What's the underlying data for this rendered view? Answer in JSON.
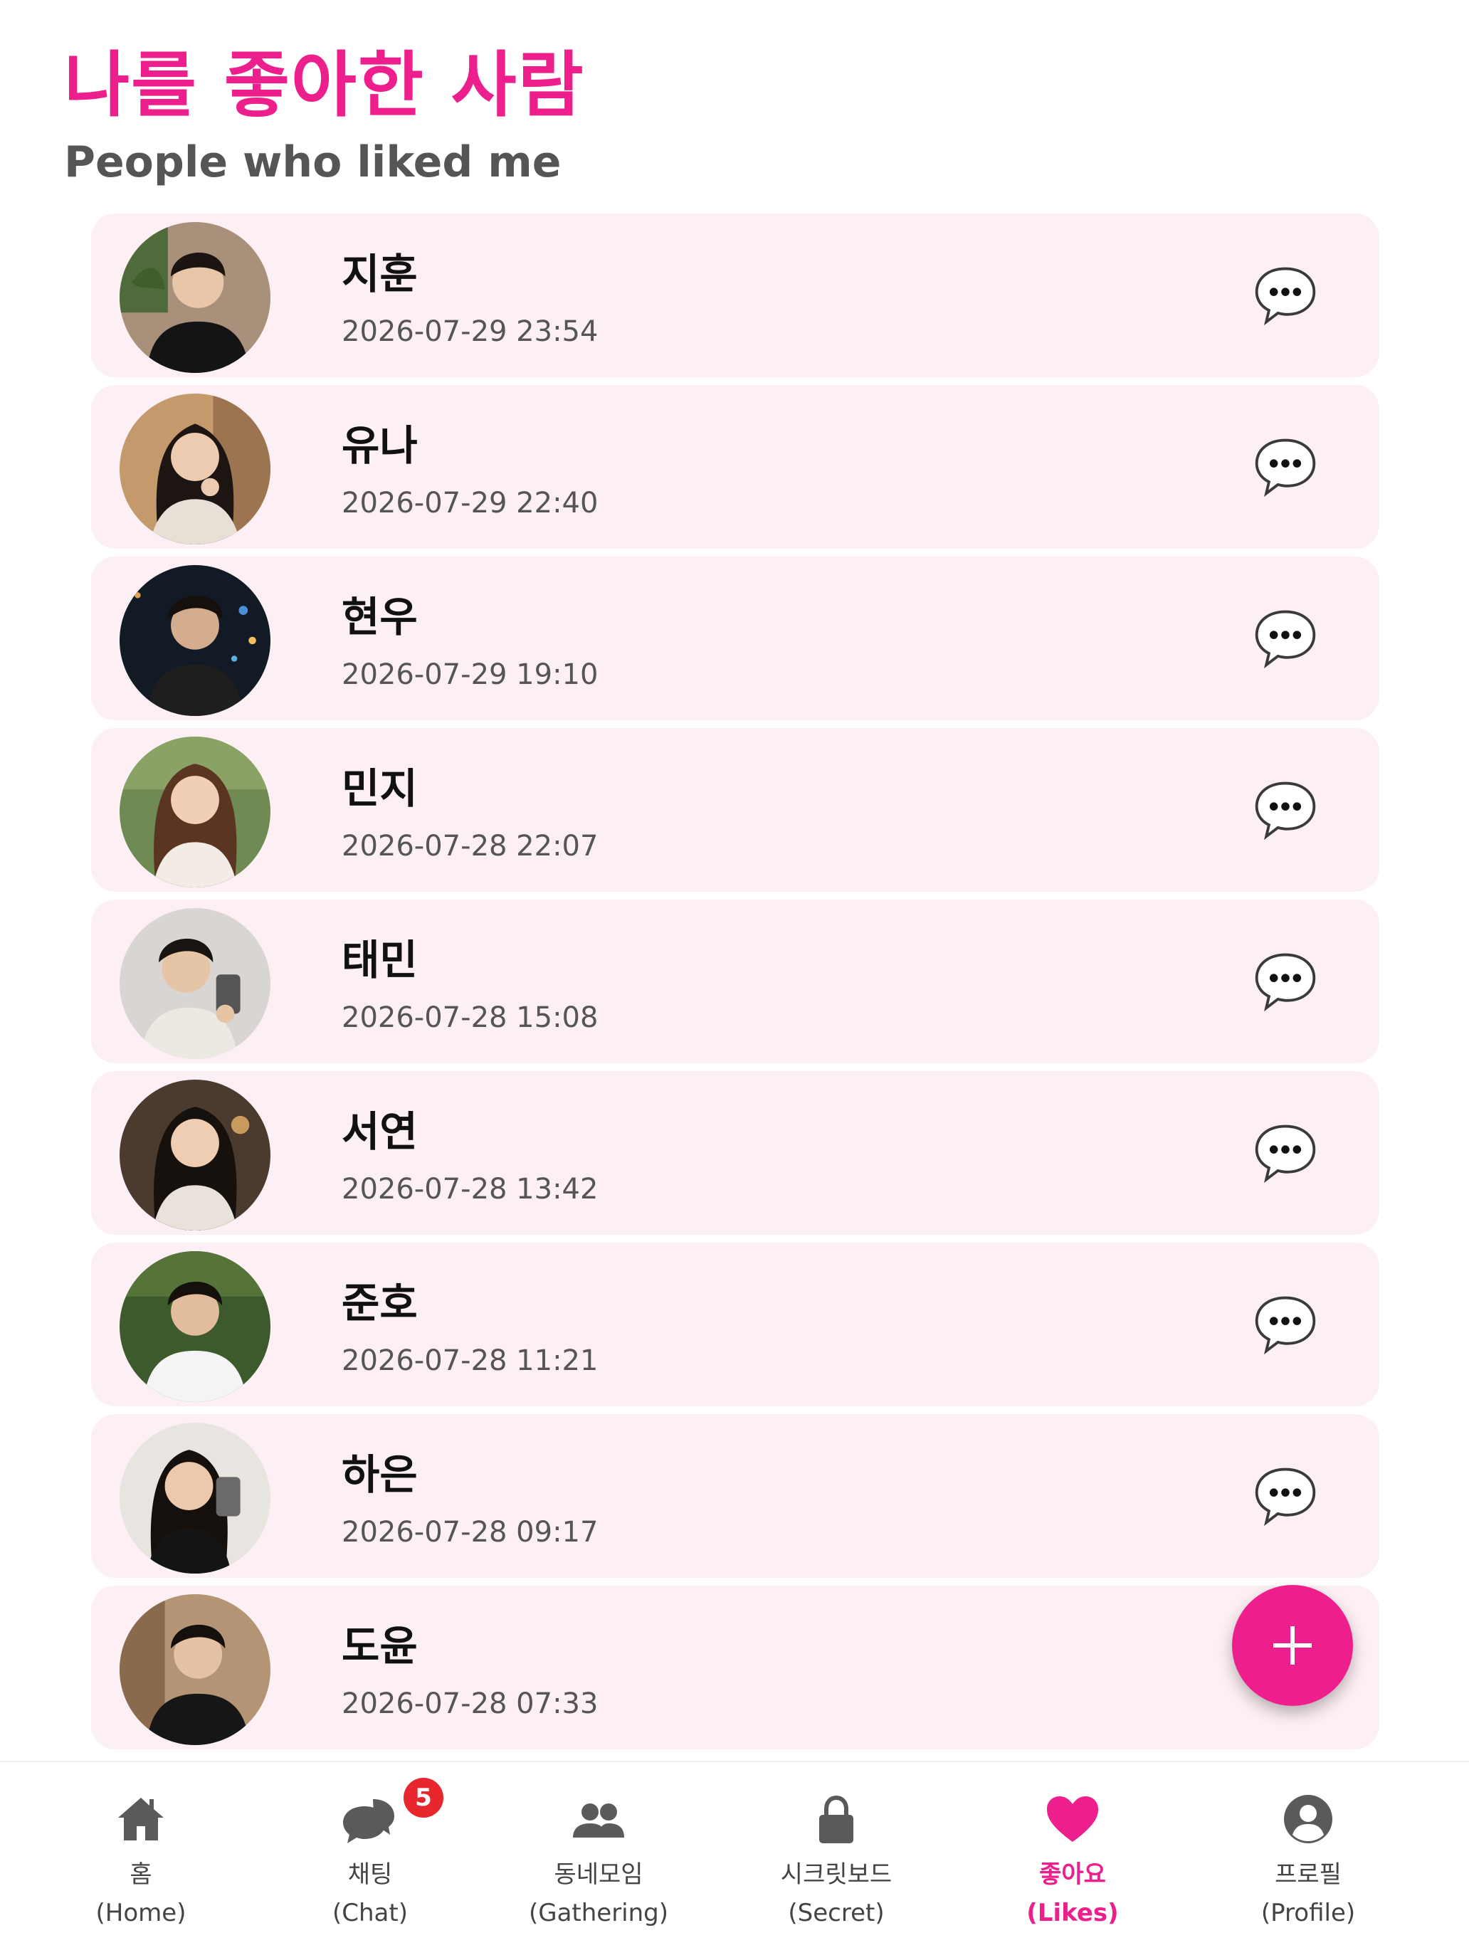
{
  "header": {
    "title": "나를 좋아한 사람",
    "subtitle": "People who liked me"
  },
  "likes": [
    {
      "name": "지훈",
      "time": "2026-07-29 23:54"
    },
    {
      "name": "유나",
      "time": "2026-07-29 22:40"
    },
    {
      "name": "현우",
      "time": "2026-07-29 19:10"
    },
    {
      "name": "민지",
      "time": "2026-07-28 22:07"
    },
    {
      "name": "태민",
      "time": "2026-07-28 15:08"
    },
    {
      "name": "서연",
      "time": "2026-07-28 13:42"
    },
    {
      "name": "준호",
      "time": "2026-07-28 11:21"
    },
    {
      "name": "하은",
      "time": "2026-07-28 09:17"
    },
    {
      "name": "도윤",
      "time": "2026-07-28 07:33"
    }
  ],
  "icons": {
    "chat_bubble": "chat-bubble-ellipsis-icon",
    "fab": "plus-icon"
  },
  "nav": {
    "items": [
      {
        "label": "홈",
        "sub": "(Home)",
        "icon": "home-icon"
      },
      {
        "label": "채팅",
        "sub": "(Chat)",
        "icon": "chat-icon",
        "badge": "5"
      },
      {
        "label": "동네모임",
        "sub": "(Gathering)",
        "icon": "group-icon"
      },
      {
        "label": "시크릿보드",
        "sub": "(Secret)",
        "icon": "lock-icon"
      },
      {
        "label": "좋아요",
        "sub": "(Likes)",
        "icon": "heart-icon"
      },
      {
        "label": "프로필",
        "sub": "(Profile)",
        "icon": "profile-icon"
      }
    ]
  },
  "colors": {
    "accent": "#ec1f8c",
    "card_background": "#fdf0f5",
    "badge": "#e8262e",
    "nav_icon": "#5a5a5a"
  }
}
